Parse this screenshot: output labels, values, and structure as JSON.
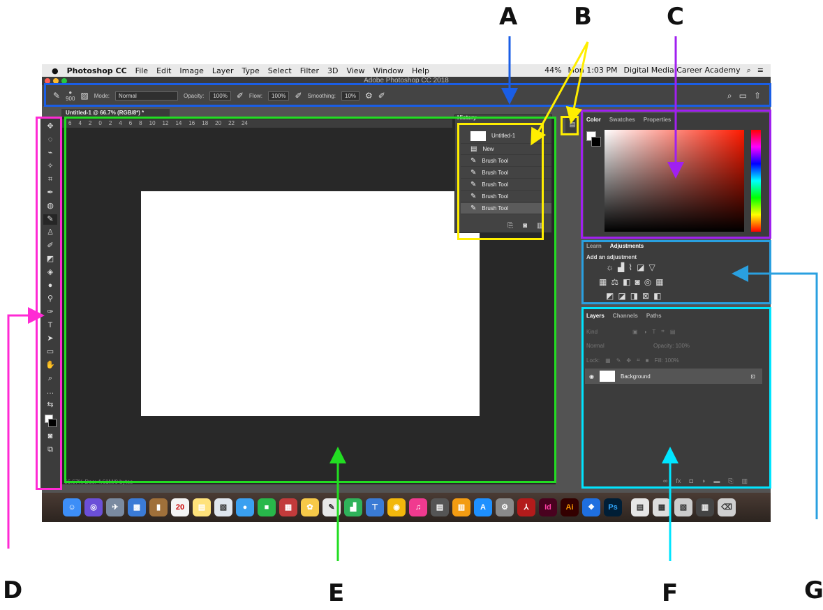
{
  "menubar": {
    "app": "Photoshop CC",
    "items": [
      "File",
      "Edit",
      "Image",
      "Layer",
      "Type",
      "Select",
      "Filter",
      "3D",
      "View",
      "Window",
      "Help"
    ],
    "battery": "44%",
    "time": "Mon 1:03 PM",
    "user": "Digital Media Career Academy"
  },
  "window": {
    "title": "Adobe Photoshop CC 2018"
  },
  "options": {
    "brush_size": "900",
    "mode_label": "Mode:",
    "mode_value": "Normal",
    "opacity_label": "Opacity:",
    "opacity_value": "100%",
    "flow_label": "Flow:",
    "flow_value": "100%",
    "smoothing_label": "Smoothing:",
    "smoothing_value": "10%"
  },
  "document": {
    "tab_title": "Untitled-1 @ 66.7% (RGB/8*) *",
    "ruler_ticks": [
      "6",
      "4",
      "2",
      "0",
      "2",
      "4",
      "6",
      "8",
      "10",
      "12",
      "14",
      "16",
      "18",
      "20",
      "22",
      "24"
    ],
    "status": "66.67%     Doc: 4.61M/0 bytes"
  },
  "history": {
    "tab": "History",
    "snapshot": "Untitled-1",
    "items": [
      "New",
      "Brush Tool",
      "Brush Tool",
      "Brush Tool",
      "Brush Tool",
      "Brush Tool"
    ]
  },
  "color_panel": {
    "tabs": [
      "Color",
      "Swatches",
      "Properties"
    ]
  },
  "adjustments_panel": {
    "tabs": [
      "Learn",
      "Adjustments"
    ],
    "title": "Add an adjustment"
  },
  "layers_panel": {
    "tabs": [
      "Layers",
      "Channels",
      "Paths"
    ],
    "kind": "Kind",
    "blend": "Normal",
    "opacity": "Opacity: 100%",
    "lock": "Lock:",
    "fill": "Fill: 100%",
    "layer_name": "Background"
  },
  "dock": {
    "apps": [
      "Id",
      "Ai",
      "Ps"
    ]
  },
  "annotations": {
    "labels": [
      "A",
      "B",
      "C",
      "D",
      "E",
      "F",
      "G"
    ]
  },
  "colors": {
    "box_a": "#1a5ee6",
    "box_b": "#ffee00",
    "box_c": "#a020f0",
    "box_d": "#ff2ad4",
    "box_e": "#22dd22",
    "box_f": "#00e5ff",
    "box_g": "#2aa0e0"
  }
}
